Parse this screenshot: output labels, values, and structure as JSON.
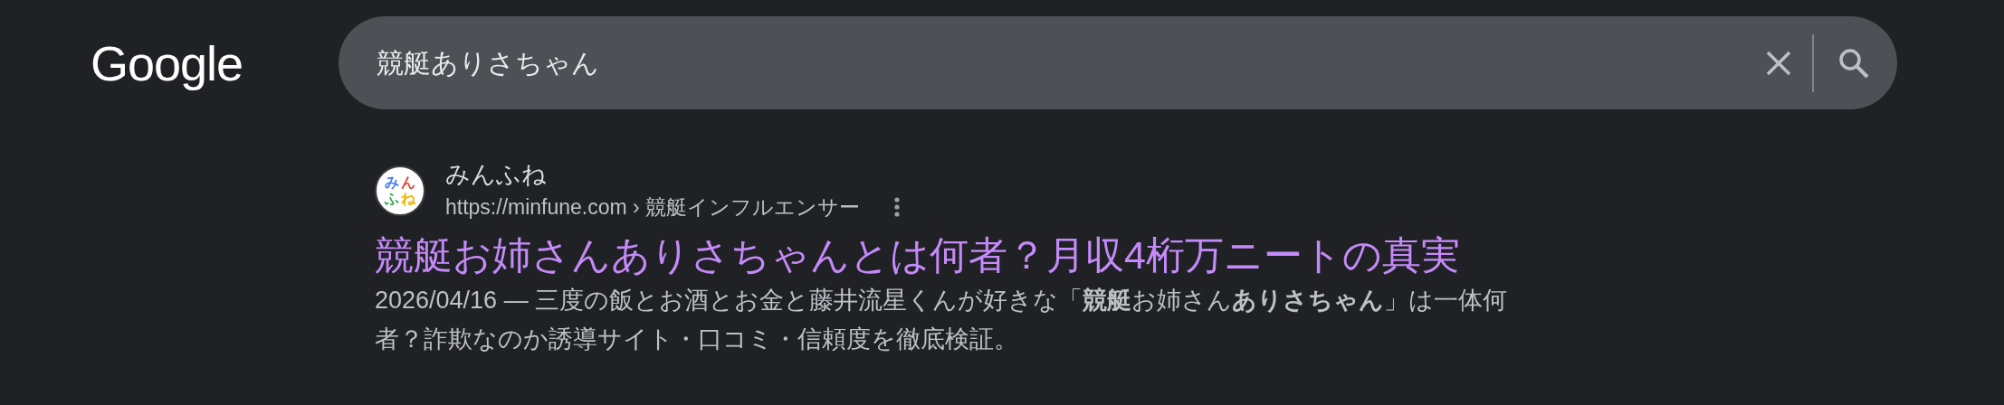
{
  "header": {
    "logo": "Google",
    "search": {
      "value": "競艇ありさちゃん"
    }
  },
  "results": [
    {
      "favicon": [
        {
          "text": "み",
          "color": "#4a7cf0"
        },
        {
          "text": "ん",
          "color": "#e8453c"
        },
        {
          "text": "ふ",
          "color": "#34a853"
        },
        {
          "text": "ね",
          "color": "#f5b400"
        }
      ],
      "site": "みんふね",
      "url": "https://minfune.com › 競艇インフルエンサー",
      "title": "競艇お姉さんありさちゃんとは何者？月収4桁万ニートの真実",
      "snippet": "2026/04/16 — 三度の飯とお酒とお金と藤井流星くんが好きな「**競艇**お姉さん**ありさちゃん**」は一体何者？詐欺なのか誘導サイト・口コミ・信頼度を徹底検証。"
    }
  ]
}
